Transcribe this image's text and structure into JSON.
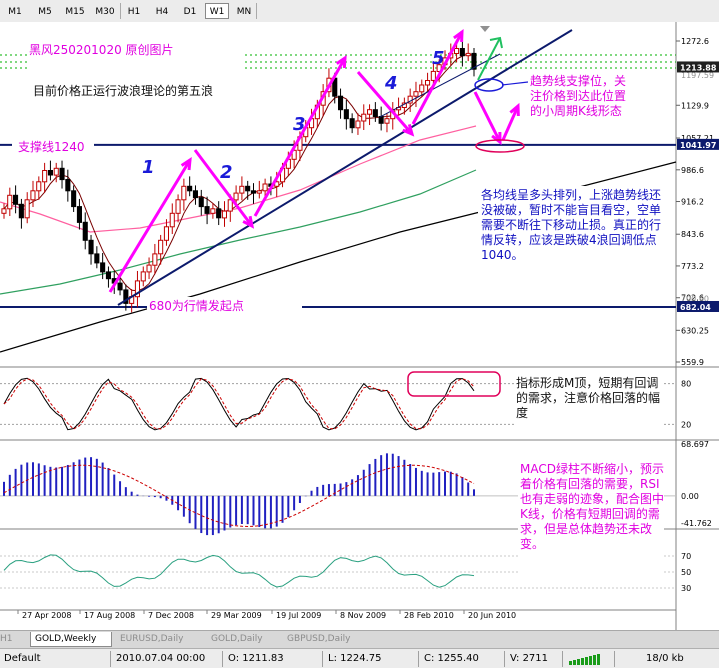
{
  "toolbar": {
    "timeframes": [
      {
        "label": "M1",
        "active": false
      },
      {
        "label": "M5",
        "active": false
      },
      {
        "label": "M15",
        "active": false
      },
      {
        "label": "M30",
        "active": false
      },
      {
        "label": "H1",
        "active": false
      },
      {
        "label": "H4",
        "active": false
      },
      {
        "label": "D1",
        "active": false
      },
      {
        "label": "W1",
        "active": true
      },
      {
        "label": "MN",
        "active": false
      }
    ]
  },
  "chart_data": {
    "type": "candlestick",
    "symbol": "GOLD",
    "period": "Weekly",
    "x_ticks": [
      "27 Apr 2008",
      "17 Aug 2008",
      "7 Dec 2008",
      "29 Mar 2009",
      "19 Jul 2009",
      "8 Nov 2009",
      "28 Feb 2010",
      "20 Jun 2010"
    ],
    "price_axis_ticks": [
      1272.6,
      1129.9,
      1057.21,
      986.6,
      916.2,
      843.6,
      773.2,
      702.6,
      630.25,
      559.9
    ],
    "price_labels_highlighted": [
      {
        "value": "1213.88",
        "style": "dark"
      },
      {
        "value": "1041.97",
        "style": "navy"
      },
      {
        "value": "682.04",
        "style": "navy"
      }
    ],
    "price_labels_faint": [
      "1197.59",
      "700.60"
    ],
    "close_series": [
      900,
      930,
      910,
      880,
      920,
      940,
      960,
      985,
      975,
      990,
      965,
      940,
      905,
      870,
      830,
      800,
      780,
      760,
      745,
      735,
      720,
      690,
      705,
      740,
      760,
      775,
      800,
      830,
      860,
      890,
      920,
      950,
      940,
      925,
      905,
      890,
      900,
      880,
      895,
      920,
      935,
      950,
      940,
      935,
      940,
      955,
      950,
      960,
      990,
      1010,
      1030,
      1060,
      1080,
      1100,
      1130,
      1160,
      1190,
      1150,
      1120,
      1100,
      1080,
      1095,
      1110,
      1120,
      1105,
      1090,
      1100,
      1120,
      1125,
      1135,
      1150,
      1160,
      1175,
      1185,
      1205,
      1220,
      1235,
      1245,
      1256,
      1240,
      1245,
      1210
    ],
    "support_lines": [
      1041.97,
      682.04
    ],
    "wave_labels": [
      "1",
      "2",
      "3",
      "4",
      "5"
    ],
    "stochastic": {
      "levels": [
        80,
        20
      ],
      "ticks": [
        "80",
        "20"
      ]
    },
    "macd": {
      "ticks": [
        "68.697",
        "0.00",
        "-41.762"
      ]
    },
    "rsi": {
      "ticks": [
        "70",
        "50",
        "30"
      ]
    }
  },
  "annotations": {
    "title": "黑风250201020 原创图片",
    "wave5_note": "目前价格正运行波浪理论的第五浪",
    "support_label": "支撑线1240",
    "start_label": "680为行情发起点",
    "trend_support_note": "趋势线支撑位，关注价格到达此位置的小周期K线形态",
    "ma_note": "各均线呈多头排列，上涨趋势线还没被破，暂时不能盲目看空，空单需要不断往下移动止损。真正的行情反转，应该是跌破4浪回调低点1040。",
    "stoch_note": "指标形成M顶，短期有回调的需求，注意价格回落的幅度",
    "macd_note": "MACD绿柱不断缩小，预示着价格有回落的需要，RSI也有走弱的迹象，配合图中K线，价格有短期回调的需求，但是总体趋势还未改变。"
  },
  "tabs": [
    {
      "label": "H1",
      "active": false
    },
    {
      "label": "GOLD,Weekly",
      "active": true
    },
    {
      "label": "EURUSD,Daily",
      "active": false
    },
    {
      "label": "GOLD,Daily",
      "active": false
    },
    {
      "label": "GBPUSD,Daily",
      "active": false
    }
  ],
  "status": {
    "profile": "Default",
    "datetime": "2010.07.04 00:00",
    "open": "O: 1211.83",
    "low": "L: 1224.75",
    "close": "C: 1255.40",
    "volume": "V: 2711",
    "traffic": "18/0 kb"
  },
  "colors": {
    "candle_up": "#c00000",
    "candle_down": "#000000",
    "ma_fast": "#7a0000",
    "ma_mid": "#ff60a0",
    "ma_slow": "#30a060",
    "ma_long": "#000000",
    "support_line": "#0c1a6c",
    "wave_arrow": "#ff00ff",
    "trend_line": "#0c1a6c",
    "dotted_level": "#00b000",
    "macd_hist": "#2020c0",
    "macd_signal": "#cc0000",
    "rsi_line": "#2aa080",
    "stoch_main": "#000000",
    "stoch_signal": "#cc0000"
  }
}
